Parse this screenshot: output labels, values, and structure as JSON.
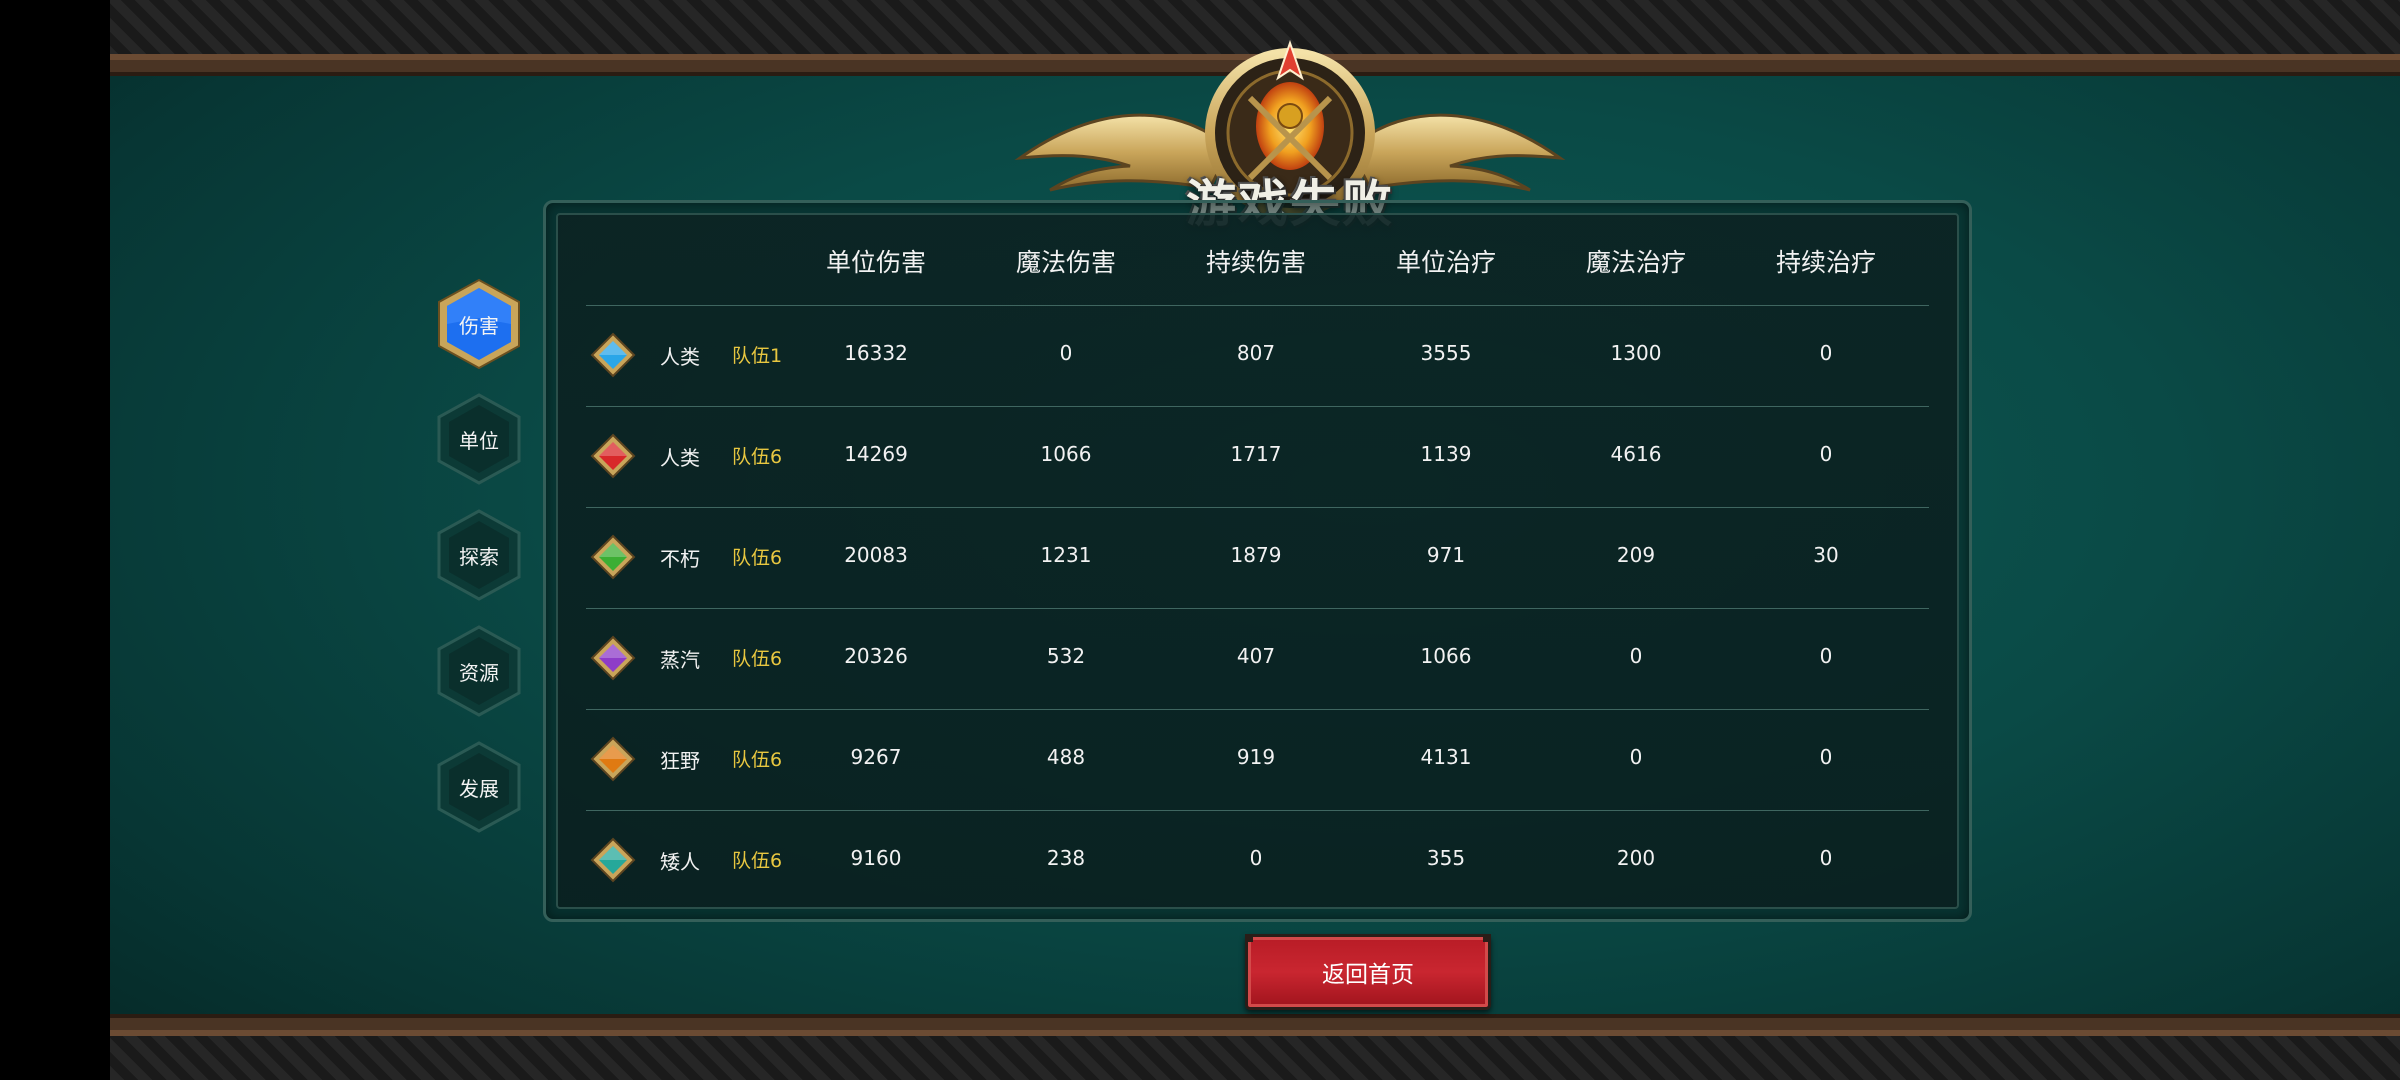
{
  "title": "游戏失败",
  "tabs": [
    {
      "label": "伤害",
      "active": true
    },
    {
      "label": "单位",
      "active": false
    },
    {
      "label": "探索",
      "active": false
    },
    {
      "label": "资源",
      "active": false
    },
    {
      "label": "发展",
      "active": false
    }
  ],
  "table": {
    "headers": [
      "单位伤害",
      "魔法伤害",
      "持续伤害",
      "单位治疗",
      "魔法治疗",
      "持续治疗"
    ],
    "rows": [
      {
        "gem_color": "#2aa6e8",
        "race": "人类",
        "team": "队伍1",
        "values": [
          "16332",
          "0",
          "807",
          "3555",
          "1300",
          "0"
        ]
      },
      {
        "gem_color": "#d8282a",
        "race": "人类",
        "team": "队伍6",
        "values": [
          "14269",
          "1066",
          "1717",
          "1139",
          "4616",
          "0"
        ]
      },
      {
        "gem_color": "#3cae34",
        "race": "不朽",
        "team": "队伍6",
        "values": [
          "20083",
          "1231",
          "1879",
          "971",
          "209",
          "30"
        ]
      },
      {
        "gem_color": "#8e3cc8",
        "race": "蒸汽",
        "team": "队伍6",
        "values": [
          "20326",
          "532",
          "407",
          "1066",
          "0",
          "0"
        ]
      },
      {
        "gem_color": "#e07a12",
        "race": "狂野",
        "team": "队伍6",
        "values": [
          "9267",
          "488",
          "919",
          "4131",
          "0",
          "0"
        ]
      },
      {
        "gem_color": "#26a89a",
        "race": "矮人",
        "team": "队伍6",
        "values": [
          "9160",
          "238",
          "0",
          "355",
          "200",
          "0"
        ]
      }
    ]
  },
  "return_button": "返回首页",
  "colors": {
    "team_text": "#e8c740",
    "active_tab": "#1d6ff0",
    "button_red": "#c92630"
  }
}
